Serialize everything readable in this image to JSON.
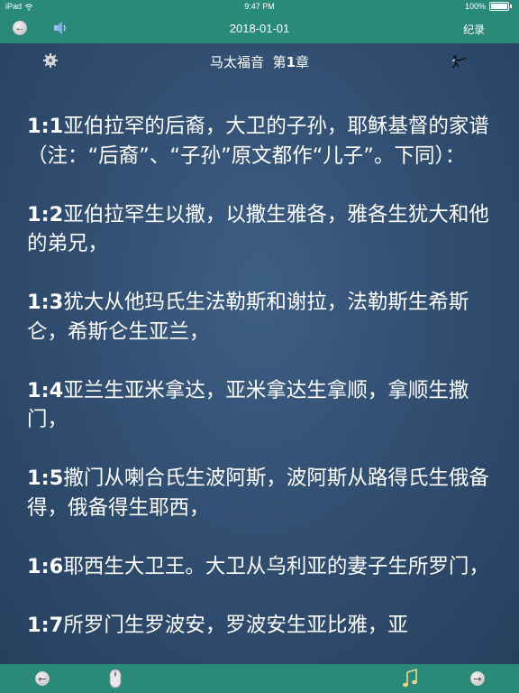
{
  "status_bar": {
    "device": "iPad",
    "time": "9:47 PM",
    "battery": "100%"
  },
  "nav": {
    "date": "2018-01-01",
    "record_label": "纪录"
  },
  "chapter": {
    "book": "马太福音",
    "chapter_prefix": "第",
    "chapter_number": "1",
    "chapter_suffix": "章"
  },
  "verses": [
    {
      "num": "1:1",
      "text": "亚伯拉罕的后裔，大卫的子孙，耶稣基督的家谱（注：“后裔”、“子孙”原文都作“儿子”。下同）："
    },
    {
      "num": "1:2",
      "text": "亚伯拉罕生以撒，以撒生雅各，雅各生犹大和他的弟兄，"
    },
    {
      "num": "1:3",
      "text": "犹大从他玛氏生法勒斯和谢拉，法勒斯生希斯仑，希斯仑生亚兰，"
    },
    {
      "num": "1:4",
      "text": "亚兰生亚米拿达，亚米拿达生拿顺，拿顺生撒门，"
    },
    {
      "num": "1:5",
      "text": "撒门从喇合氏生波阿斯，波阿斯从路得氏生俄备得，俄备得生耶西，"
    },
    {
      "num": "1:6",
      "text": "耶西生大卫王。大卫从乌利亚的妻子生所罗门，"
    },
    {
      "num": "1:7",
      "text": "所罗门生罗波安，罗波安生亚比雅，亚"
    }
  ],
  "icons": {
    "back": "back-arrow-icon",
    "speaker": "speaker-icon",
    "settings": "gear-icon",
    "fencer": "fencer-icon",
    "prev": "prev-arrow-icon",
    "mouse": "mouse-icon",
    "music": "music-note-icon",
    "next": "next-arrow-icon"
  },
  "colors": {
    "bar": "#2a8a7a",
    "background": "#2f4a6b",
    "text": "#ffffff"
  }
}
